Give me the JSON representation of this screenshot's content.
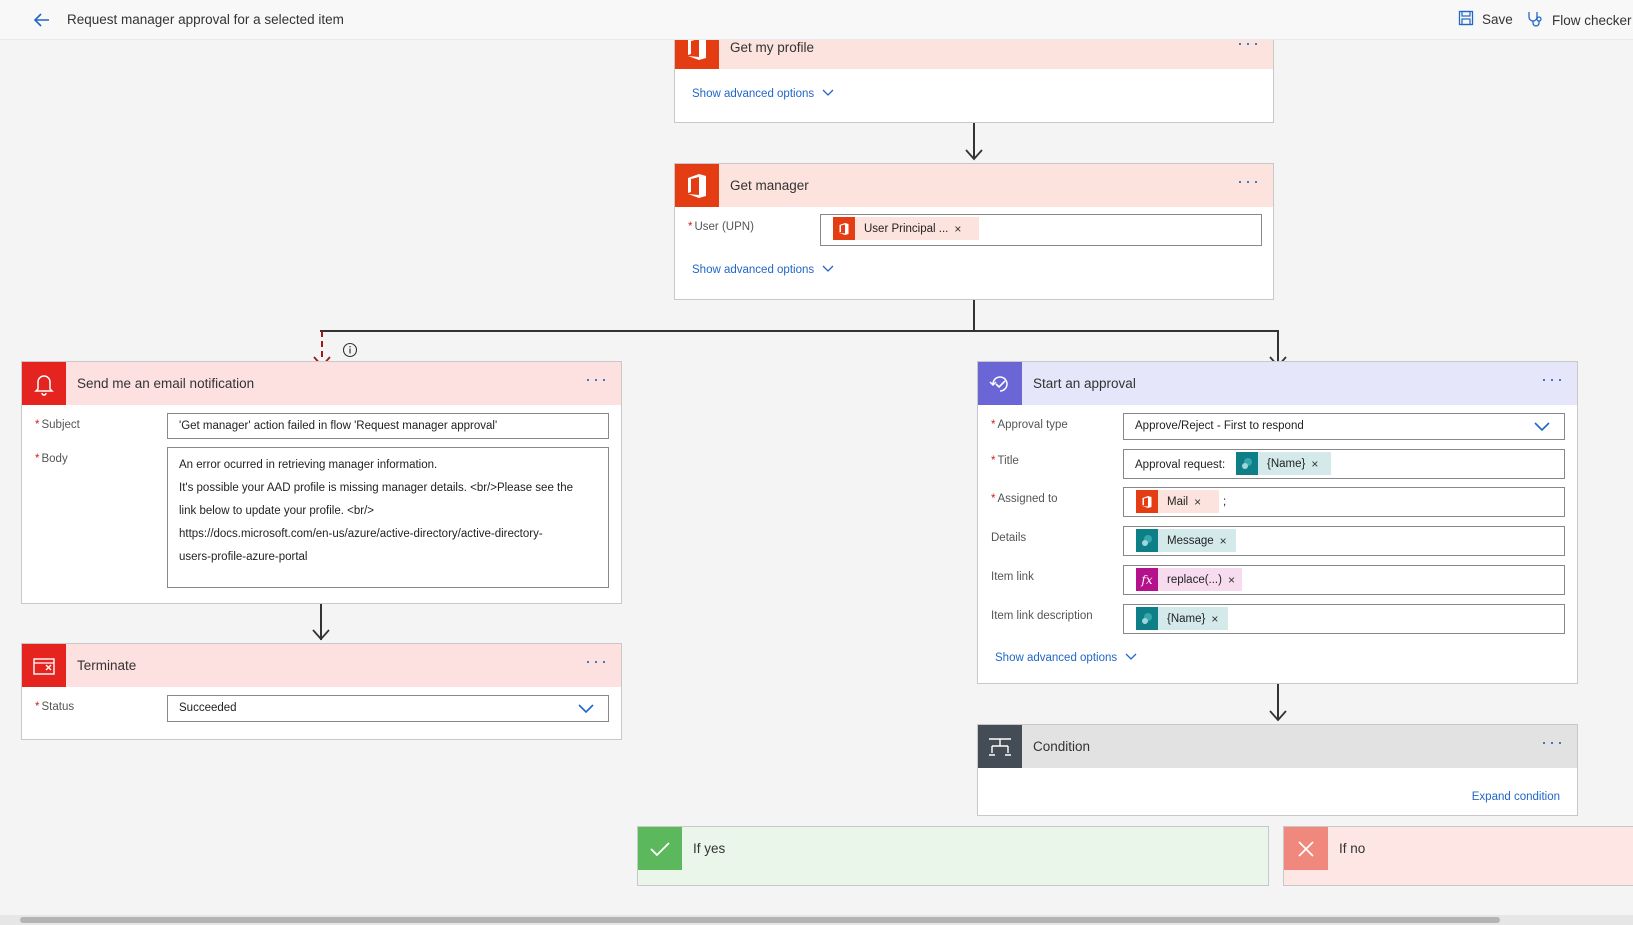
{
  "header": {
    "title": "Request manager approval for a selected item",
    "save_label": "Save",
    "flow_checker_label": "Flow checker"
  },
  "get_my_profile": {
    "title": "Get my profile",
    "advanced_label": "Show advanced options"
  },
  "get_manager": {
    "title": "Get manager",
    "user_label": "User (UPN)",
    "user_token": "User Principal ...",
    "advanced_label": "Show advanced options"
  },
  "email_notification": {
    "title": "Send me an email notification",
    "subject_label": "Subject",
    "subject_value": "'Get manager' action failed in flow 'Request manager approval'",
    "body_label": "Body",
    "body_lines": [
      "An error ocurred in retrieving manager information.",
      "It's possible your AAD profile is missing manager details.  <br/>Please see the",
      "link below to update your profile. <br/>",
      "https://docs.microsoft.com/en-us/azure/active-directory/active-directory-",
      "users-profile-azure-portal"
    ]
  },
  "terminate": {
    "title": "Terminate",
    "status_label": "Status",
    "status_value": "Succeeded"
  },
  "approval": {
    "title": "Start an approval",
    "type_label": "Approval type",
    "type_value": "Approve/Reject - First to respond",
    "title_label": "Title",
    "title_prefix": "Approval request:",
    "title_token": "{Name}",
    "assigned_label": "Assigned to",
    "assigned_token": "Mail",
    "assigned_suffix": ";",
    "details_label": "Details",
    "details_token": "Message",
    "item_link_label": "Item link",
    "item_link_token": "replace(...)",
    "item_link_desc_label": "Item link description",
    "item_link_desc_token": "{Name}",
    "advanced_label": "Show advanced options"
  },
  "condition": {
    "title": "Condition",
    "expand_label": "Expand condition"
  },
  "branches": {
    "yes_label": "If yes",
    "no_label": "If no"
  },
  "icons": [
    "back-arrow-icon",
    "save-icon",
    "stethoscope-icon",
    "office-icon",
    "bell-icon",
    "terminate-icon",
    "approval-icon",
    "condition-icon",
    "sharepoint-icon",
    "fx-icon",
    "check-icon",
    "x-icon",
    "info-icon",
    "chevron-down-icon",
    "more-icon"
  ],
  "colors": {
    "accent": "#2266c8",
    "office": "#e43c13",
    "alert": "#e5231f",
    "approval": "#6a66d6",
    "condition": "#444c56",
    "sharepoint": "#0e7f86",
    "expression": "#b5118c",
    "yes": "#5cb85c",
    "no": "#f0887e"
  }
}
